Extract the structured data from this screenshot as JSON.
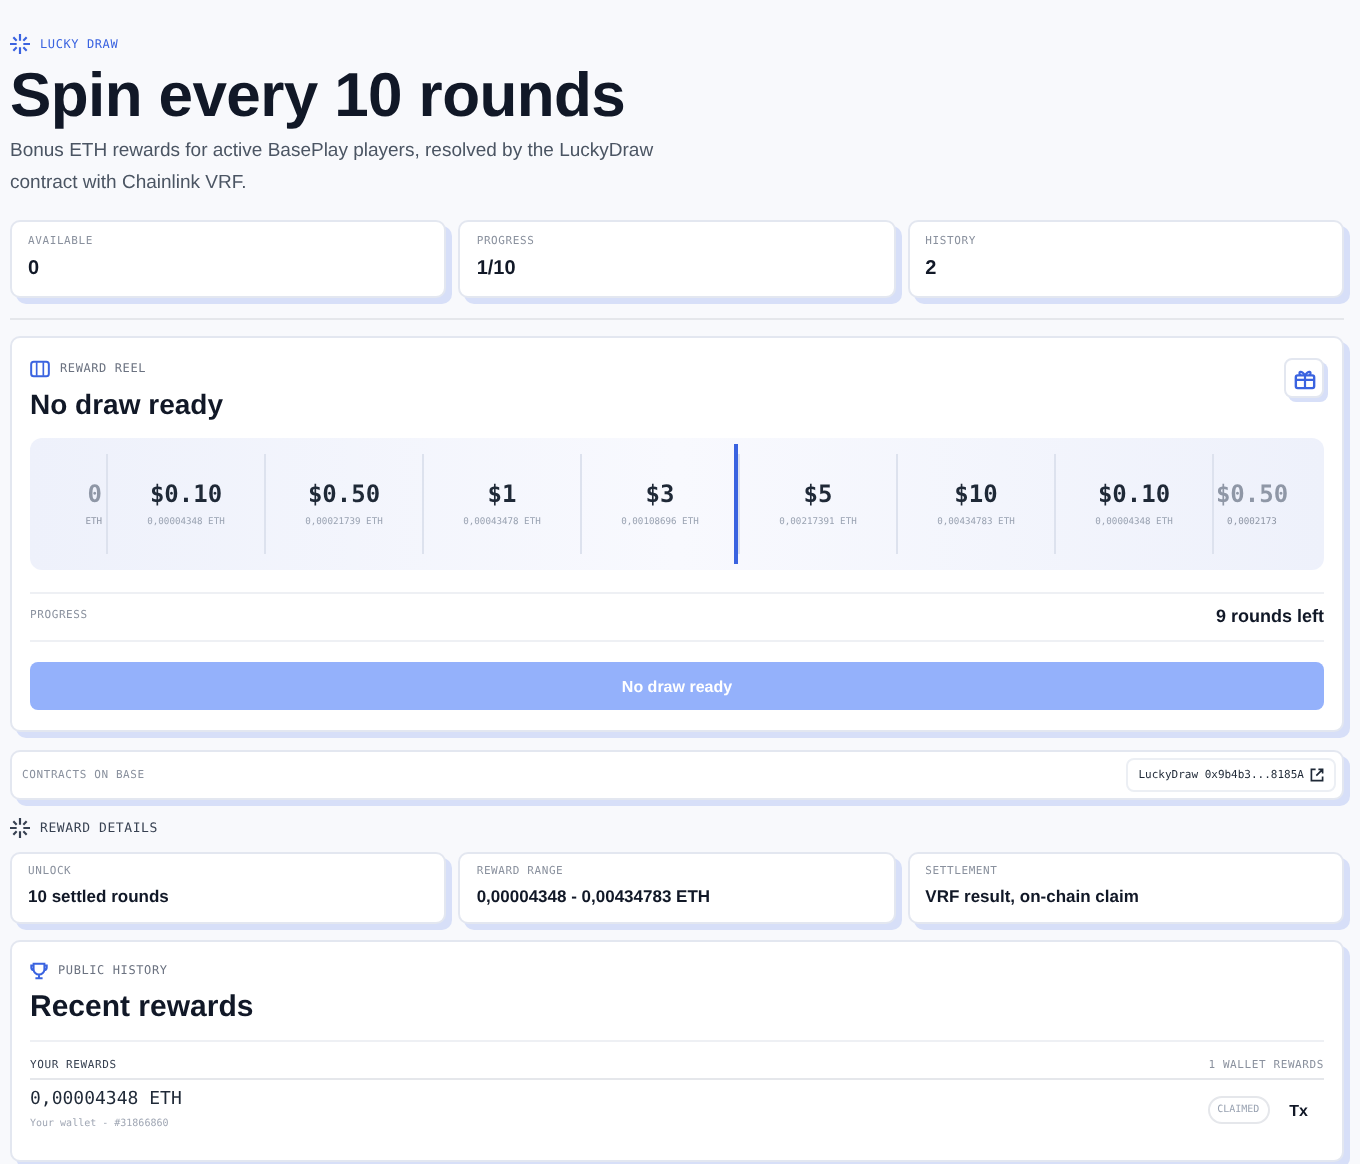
{
  "eyebrow": "LUCKY DRAW",
  "title": "Spin every 10 rounds",
  "description": "Bonus ETH rewards for active BasePlay players, resolved by the LuckyDraw contract with Chainlink VRF.",
  "stats": [
    {
      "label": "AVAILABLE",
      "value": "0"
    },
    {
      "label": "PROGRESS",
      "value": "1/10"
    },
    {
      "label": "HISTORY",
      "value": "2"
    }
  ],
  "reel_card": {
    "eyebrow": "REWARD REEL",
    "title": "No draw ready",
    "reel": [
      {
        "usd": "0",
        "eth": "ETH",
        "kind": "edge"
      },
      {
        "usd": "$0.10",
        "eth": "0,00004348 ETH",
        "kind": "full"
      },
      {
        "usd": "$0.50",
        "eth": "0,00021739 ETH",
        "kind": "full"
      },
      {
        "usd": "$1",
        "eth": "0,00043478 ETH",
        "kind": "full"
      },
      {
        "usd": "$3",
        "eth": "0,00108696 ETH",
        "kind": "full"
      },
      {
        "usd": "$5",
        "eth": "0,00217391 ETH",
        "kind": "full"
      },
      {
        "usd": "$10",
        "eth": "0,00434783 ETH",
        "kind": "full"
      },
      {
        "usd": "$0.10",
        "eth": "0,00004348 ETH",
        "kind": "full"
      },
      {
        "usd": "$0.50",
        "eth": "0,0002173",
        "kind": "edge"
      }
    ],
    "progress_label": "PROGRESS",
    "progress_value": "9 rounds left",
    "button": {
      "label": "No draw ready",
      "disabled": true
    }
  },
  "contracts": {
    "label": "CONTRACTS ON BASE",
    "link": "LuckyDraw 0x9b4b3...8185A"
  },
  "details_heading": "REWARD DETAILS",
  "details": [
    {
      "label": "UNLOCK",
      "value": "10 settled rounds"
    },
    {
      "label": "REWARD RANGE",
      "value": "0,00004348 - 0,00434783 ETH"
    },
    {
      "label": "SETTLEMENT",
      "value": "VRF result, on-chain claim"
    }
  ],
  "history": {
    "eyebrow": "PUBLIC HISTORY",
    "title": "Recent rewards",
    "list_label": "YOUR REWARDS",
    "count": "1 WALLET REWARDS",
    "rows": [
      {
        "amount": "0,00004348 ETH",
        "sub": "Your wallet - #31866860",
        "status": "CLAIMED",
        "link": "Tx"
      }
    ]
  }
}
